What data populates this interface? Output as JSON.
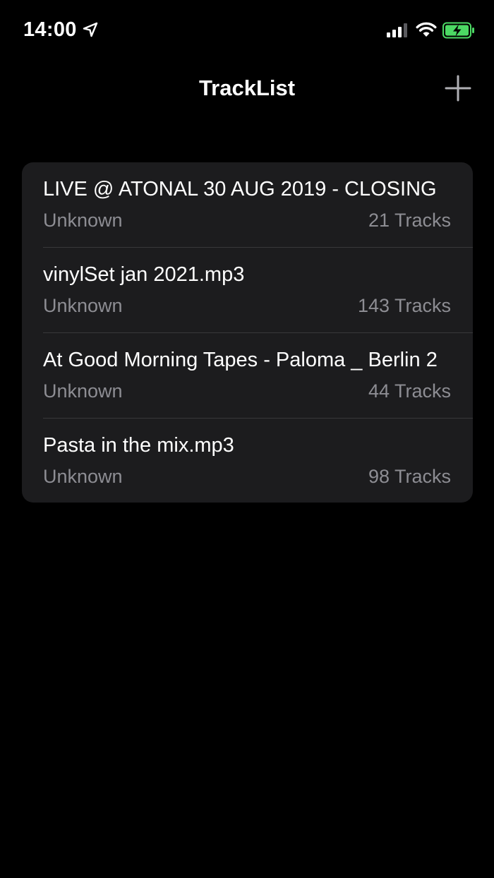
{
  "status_bar": {
    "time": "14:00",
    "icons": [
      "location-arrow-icon",
      "cellular-signal-icon",
      "wifi-icon",
      "battery-charging-icon"
    ],
    "battery_color": "#4cd964"
  },
  "nav": {
    "title": "TrackList",
    "add_icon": "plus-icon"
  },
  "colors": {
    "background": "#000000",
    "card": "#1c1c1e",
    "separator": "#38383a",
    "primary_text": "#ffffff",
    "secondary_text": "#8d8d93"
  },
  "tracklists": [
    {
      "title": "LIVE @ ATONAL 30 AUG 2019 - CLOSING",
      "artist": "Unknown",
      "count": "21 Tracks"
    },
    {
      "title": "vinylSet jan 2021.mp3",
      "artist": "Unknown",
      "count": "143 Tracks"
    },
    {
      "title": "At Good Morning Tapes - Paloma _ Berlin 2",
      "artist": "Unknown",
      "count": "44 Tracks"
    },
    {
      "title": "Pasta in the mix.mp3",
      "artist": "Unknown",
      "count": "98 Tracks"
    }
  ]
}
